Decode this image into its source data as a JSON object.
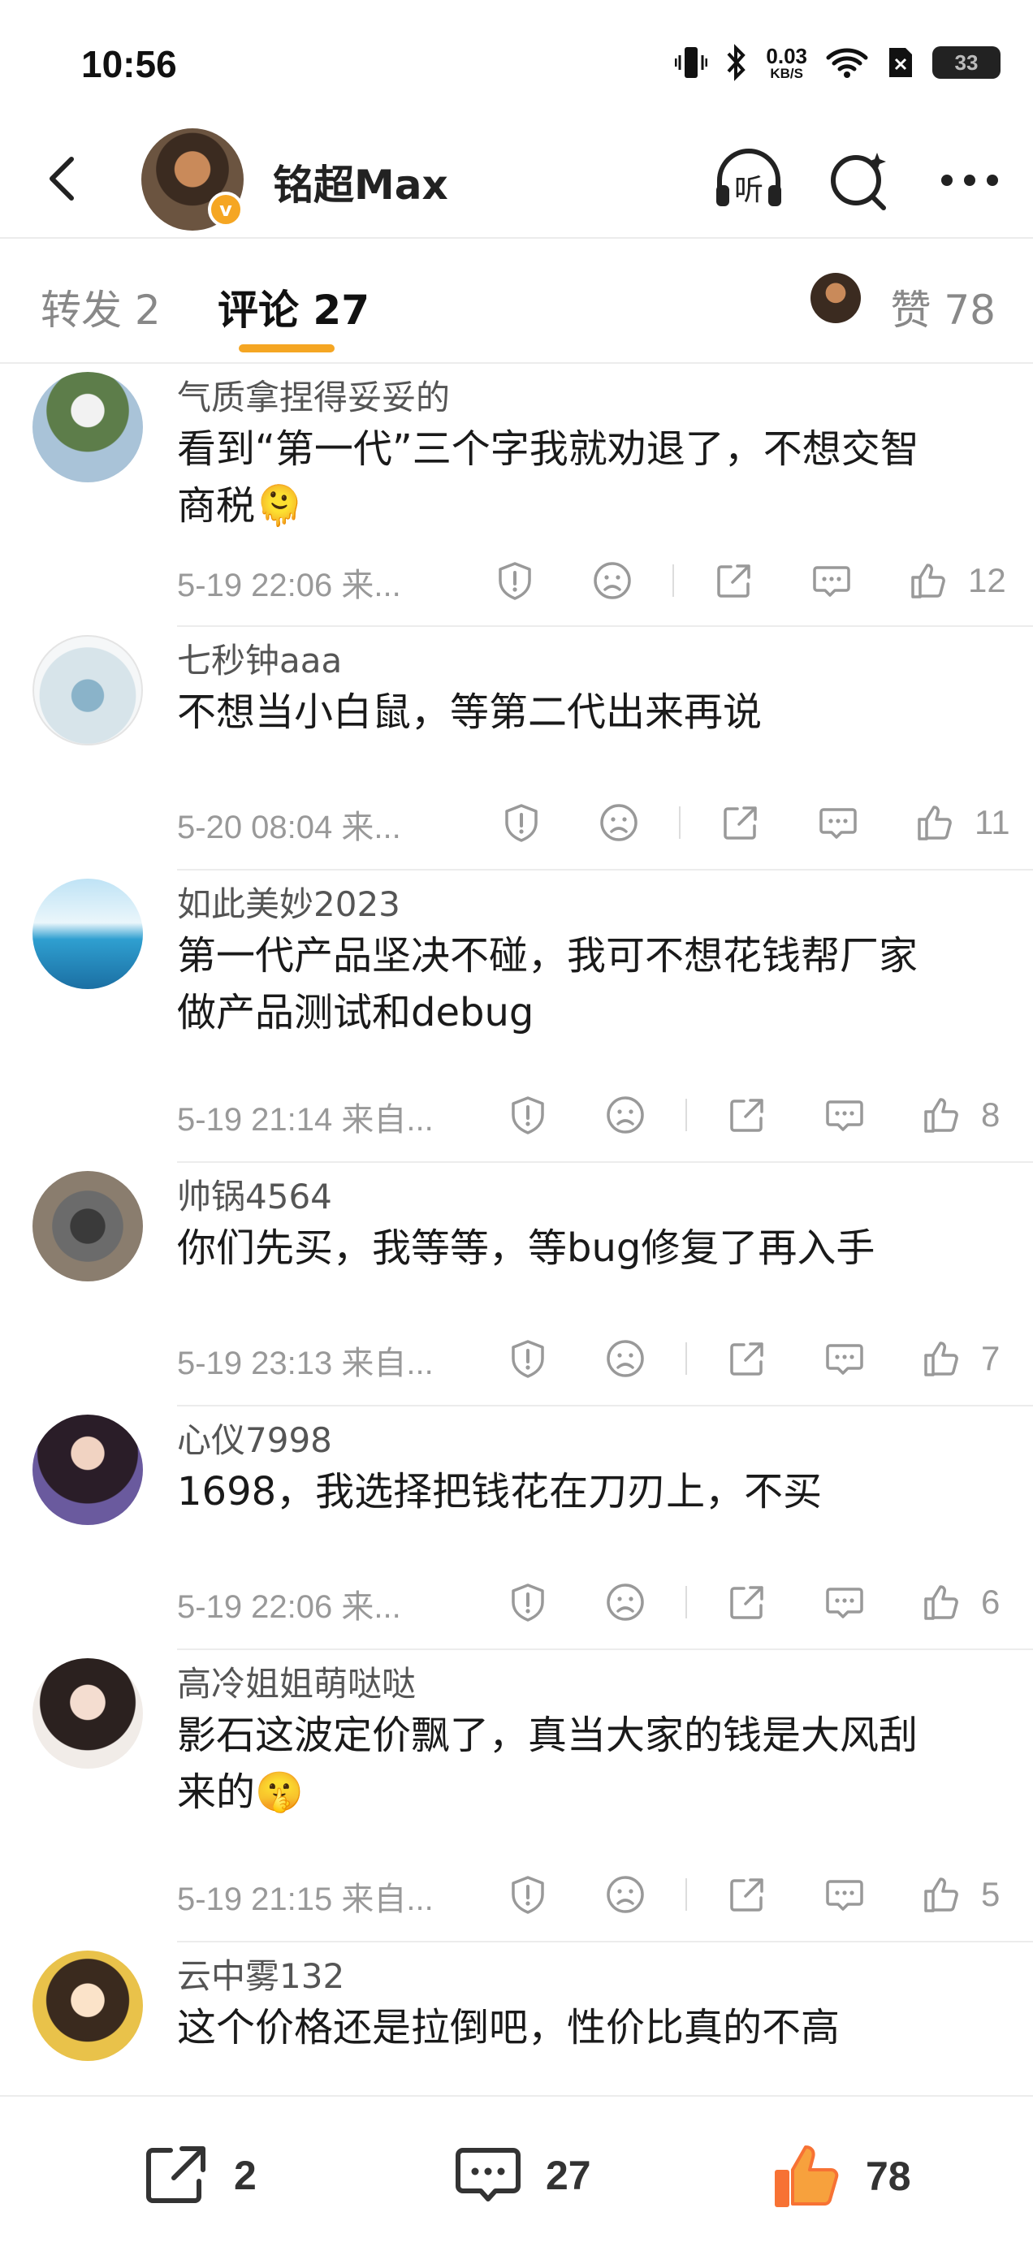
{
  "status": {
    "time": "10:56",
    "net_value": "0.03",
    "net_unit": "KB/S",
    "battery": "33"
  },
  "header": {
    "title": "铭超Max",
    "verified": "v"
  },
  "tabs": {
    "forward": "转发 2",
    "comments": "评论 27",
    "likes": "赞 78"
  },
  "comments": [
    {
      "name": "气质拿捏得妥妥的",
      "lines": [
        "看到“第一代”三个字我就劝退了，不想交智",
        "商税🫠"
      ],
      "meta": "5-19 22:06  来...",
      "likes": "12"
    },
    {
      "name": "七秒钟aaa",
      "lines": [
        "不想当小白鼠，等第二代出来再说"
      ],
      "meta": "5-20 08:04  来...",
      "likes": "11"
    },
    {
      "name": "如此美妙2023",
      "lines": [
        "第一代产品坚决不碰，我可不想花钱帮厂家",
        "做产品测试和debug"
      ],
      "meta": "5-19 21:14  来自...",
      "likes": "8"
    },
    {
      "name": "帅锅4564",
      "lines": [
        "你们先买，我等等，等bug修复了再入手"
      ],
      "meta": "5-19 23:13  来自...",
      "likes": "7"
    },
    {
      "name": "心仪7998",
      "lines": [
        "1698，我选择把钱花在刀刃上，不买"
      ],
      "meta": "5-19 22:06  来...",
      "likes": "6"
    },
    {
      "name": "高冷姐姐萌哒哒",
      "lines": [
        "影石这波定价飘了，真当大家的钱是大风刮",
        "来的🤫"
      ],
      "meta": "5-19 21:15  来自...",
      "likes": "5"
    },
    {
      "name": "云中雾132",
      "lines": [
        "这个价格还是拉倒吧，性价比真的不高"
      ],
      "meta": "",
      "likes": ""
    }
  ],
  "bottom": {
    "forward_count": "2",
    "comment_count": "27",
    "like_count": "78"
  },
  "colors": {
    "accent": "#f5a623",
    "like_orange": "#f77234",
    "text": "#1a1a1a",
    "muted": "#999999"
  },
  "icons": [
    "back-icon",
    "listen-icon",
    "search-icon",
    "more-icon",
    "report-icon",
    "dislike-icon",
    "share-icon",
    "reply-icon",
    "thumb-up-icon"
  ]
}
